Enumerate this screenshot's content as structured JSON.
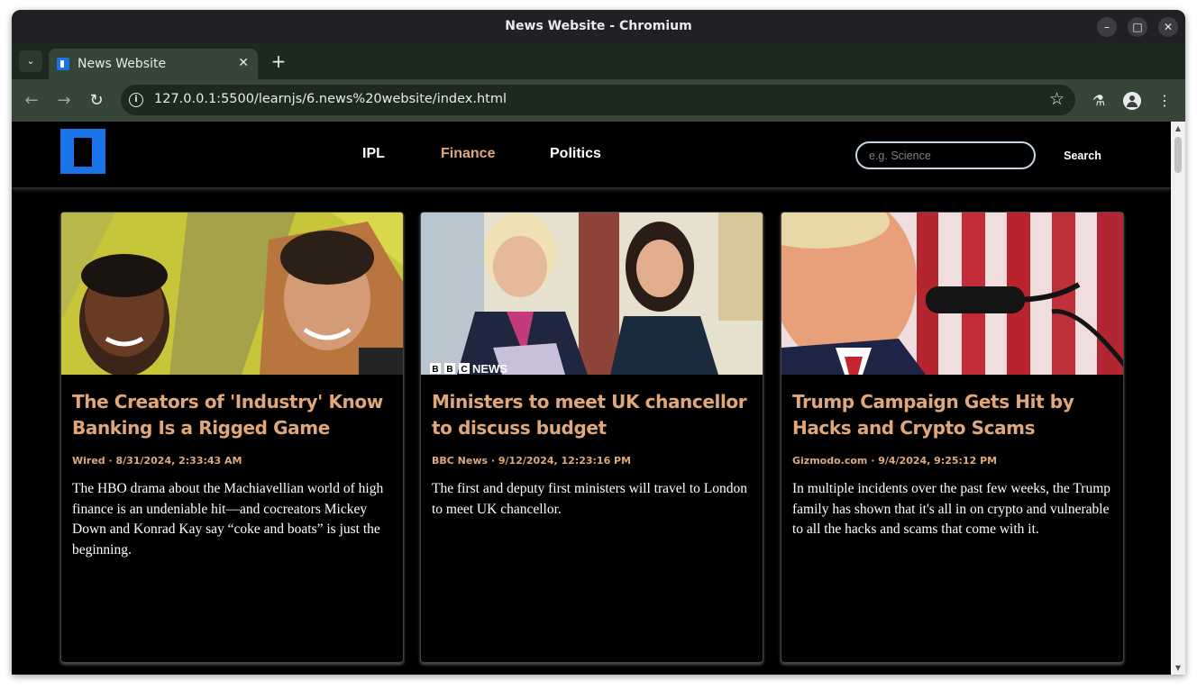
{
  "window": {
    "title": "News Website - Chromium",
    "minimize_label": "–",
    "maximize_label": "□",
    "close_label": "✕"
  },
  "tabs": [
    {
      "label": "News Website",
      "close": "✕"
    }
  ],
  "tabstrip": {
    "dropdown": "⌄",
    "new_tab": "+"
  },
  "toolbar": {
    "back": "←",
    "forward": "→",
    "reload": "↻",
    "url": "127.0.0.1:5500/learnjs/6.news%20website/index.html",
    "bookmark": "☆",
    "labs": "⚗",
    "menu": "⋮"
  },
  "site": {
    "nav": [
      "IPL",
      "Finance",
      "Politics"
    ],
    "active_nav": "Finance",
    "search": {
      "placeholder": "e.g. Science",
      "button": "Search"
    },
    "accent": "#e0a87a"
  },
  "articles": [
    {
      "title": "The Creators of 'Industry' Know Banking Is a Rigged Game",
      "meta": "Wired · 8/31/2024, 2:33:43 AM",
      "description": "The HBO drama about the Machiavellian world of high finance is an undeniable hit—and cocreators Mickey Down and Konrad Kay say “coke and boats” is just the beginning."
    },
    {
      "title": "Ministers to meet UK chancellor to discuss budget",
      "meta": "BBC News · 9/12/2024, 12:23:16 PM",
      "description": "The first and deputy first ministers will travel to London to meet UK chancellor.",
      "image_caption": "BBC NEWS",
      "image_caption_letters": [
        "B",
        "B",
        "C"
      ],
      "image_caption_word": "NEWS"
    },
    {
      "title": "Trump Campaign Gets Hit by Hacks and Crypto Scams",
      "meta": "Gizmodo.com · 9/4/2024, 9:25:12 PM",
      "description": "In multiple incidents over the past few weeks, the Trump family has shown that it's all in on crypto and vulnerable to all the hacks and scams that come with it."
    }
  ]
}
